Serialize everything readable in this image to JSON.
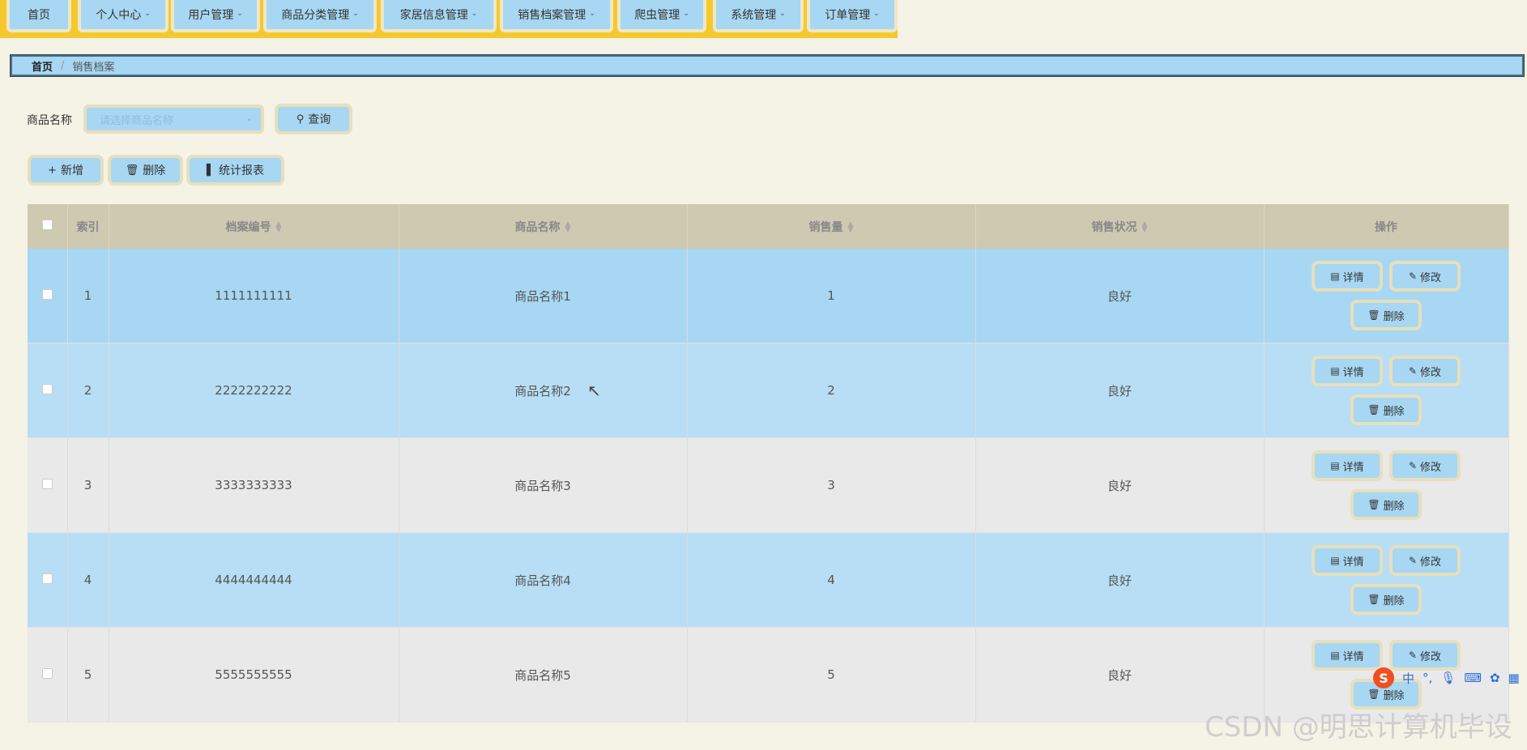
{
  "nav": {
    "items": [
      {
        "label": "首页",
        "dropdown": false
      },
      {
        "label": "个人中心",
        "dropdown": true
      },
      {
        "label": "用户管理",
        "dropdown": true
      },
      {
        "label": "商品分类管理",
        "dropdown": true
      },
      {
        "label": "家居信息管理",
        "dropdown": true
      },
      {
        "label": "销售档案管理",
        "dropdown": true
      },
      {
        "label": "爬虫管理",
        "dropdown": true
      },
      {
        "label": "系统管理",
        "dropdown": true
      },
      {
        "label": "订单管理",
        "dropdown": true
      }
    ]
  },
  "breadcrumb": {
    "home": "首页",
    "separator": "/",
    "current": "销售档案"
  },
  "search": {
    "label": "商品名称",
    "placeholder": "请选择商品名称",
    "query_button": "查询"
  },
  "toolbar": {
    "add": "新增",
    "delete": "删除",
    "report": "统计报表"
  },
  "table": {
    "headers": {
      "index": "索引",
      "archive_no": "档案编号",
      "product_name": "商品名称",
      "sales_volume": "销售量",
      "sales_status": "销售状况",
      "actions": "操作"
    },
    "action_labels": {
      "detail": "详情",
      "edit": "修改",
      "delete": "删除"
    },
    "rows": [
      {
        "index": "1",
        "archive_no": "1111111111",
        "product_name": "商品名称1",
        "sales_volume": "1",
        "sales_status": "良好"
      },
      {
        "index": "2",
        "archive_no": "2222222222",
        "product_name": "商品名称2",
        "sales_volume": "2",
        "sales_status": "良好"
      },
      {
        "index": "3",
        "archive_no": "3333333333",
        "product_name": "商品名称3",
        "sales_volume": "3",
        "sales_status": "良好"
      },
      {
        "index": "4",
        "archive_no": "4444444444",
        "product_name": "商品名称4",
        "sales_volume": "4",
        "sales_status": "良好"
      },
      {
        "index": "5",
        "archive_no": "5555555555",
        "product_name": "商品名称5",
        "sales_volume": "5",
        "sales_status": "良好"
      }
    ]
  },
  "ime": {
    "mode": "中"
  },
  "watermark": "CSDN @明思计算机毕设",
  "colors": {
    "topbar": "#f5c92e",
    "accent": "#a7d7f2",
    "header": "#cec9b1",
    "background": "#f5f2e6"
  }
}
